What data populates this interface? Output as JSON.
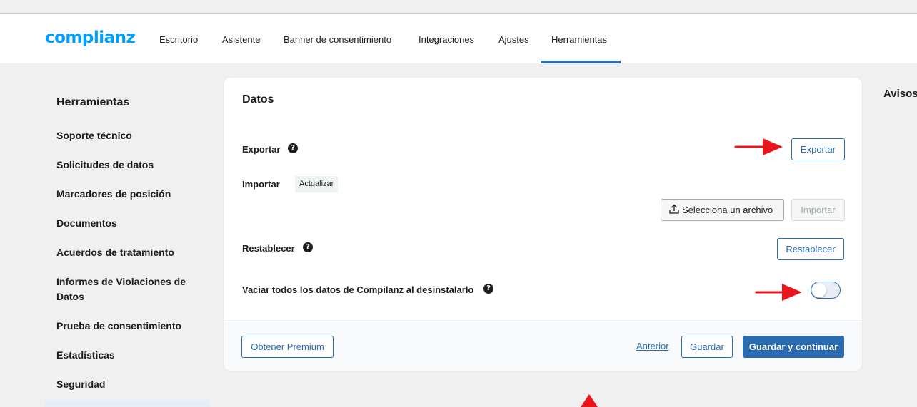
{
  "app": {
    "logo": "complianz"
  },
  "nav": {
    "items": [
      "Escritorio",
      "Asistente",
      "Banner de consentimiento",
      "Integraciones",
      "Ajustes",
      "Herramientas"
    ],
    "active": "Herramientas"
  },
  "sidebar": {
    "title": "Herramientas",
    "items": [
      "Soporte técnico",
      "Solicitudes de datos",
      "Marcadores de posición",
      "Documentos",
      "Acuerdos de tratamiento",
      "Informes de Violaciones de Datos",
      "Prueba de consentimiento",
      "Estadísticas",
      "Seguridad"
    ]
  },
  "card": {
    "title": "Datos",
    "export": {
      "label": "Exportar",
      "button": "Exportar"
    },
    "import": {
      "label": "Importar",
      "badge": "Actualizar",
      "file_button": "Selecciona un archivo",
      "import_button": "Importar"
    },
    "reset": {
      "label": "Restablecer",
      "button": "Restablecer"
    },
    "clear": {
      "label": "Vaciar todos los datos de Compilanz al desinstalarlo",
      "enabled": false
    },
    "help_glyph": "?"
  },
  "footer": {
    "premium_button": "Obtener Premium",
    "previous_link": "Anterior",
    "save_button": "Guardar",
    "save_continue_button": "Guardar y continuar"
  },
  "notices": {
    "title": "Avisos"
  },
  "colors": {
    "accent": "#2b6cb0",
    "logo": "#009fff",
    "arrow": "#e8161b"
  }
}
